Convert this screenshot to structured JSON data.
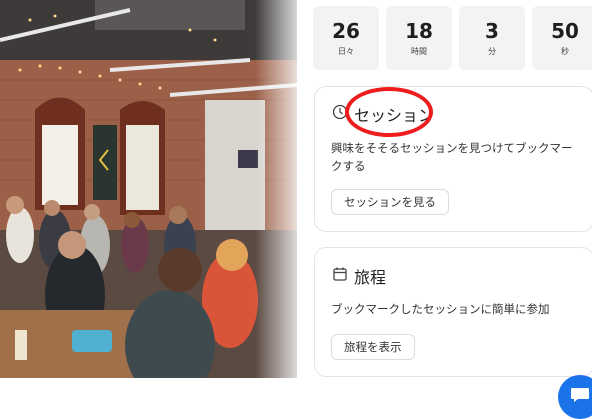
{
  "countdown": [
    {
      "value": "26",
      "unit": "日々"
    },
    {
      "value": "18",
      "unit": "時間"
    },
    {
      "value": "3",
      "unit": "分"
    },
    {
      "value": "50",
      "unit": "秒"
    }
  ],
  "sessions_card": {
    "title": "セッション",
    "description": "興味をそそるセッションを見つけてブックマークする",
    "button_label": "セッションを見る",
    "icon": "clock-icon"
  },
  "itinerary_card": {
    "title": "旅程",
    "description": "ブックマークしたセッションに簡単に参加",
    "button_label": "旅程を表示",
    "icon": "calendar-icon"
  },
  "chat_button": {
    "icon": "chat-icon"
  },
  "colors": {
    "accent": "#1a73e8",
    "annotation": "#ee1c1c",
    "box_bg": "#f2f3f5"
  }
}
